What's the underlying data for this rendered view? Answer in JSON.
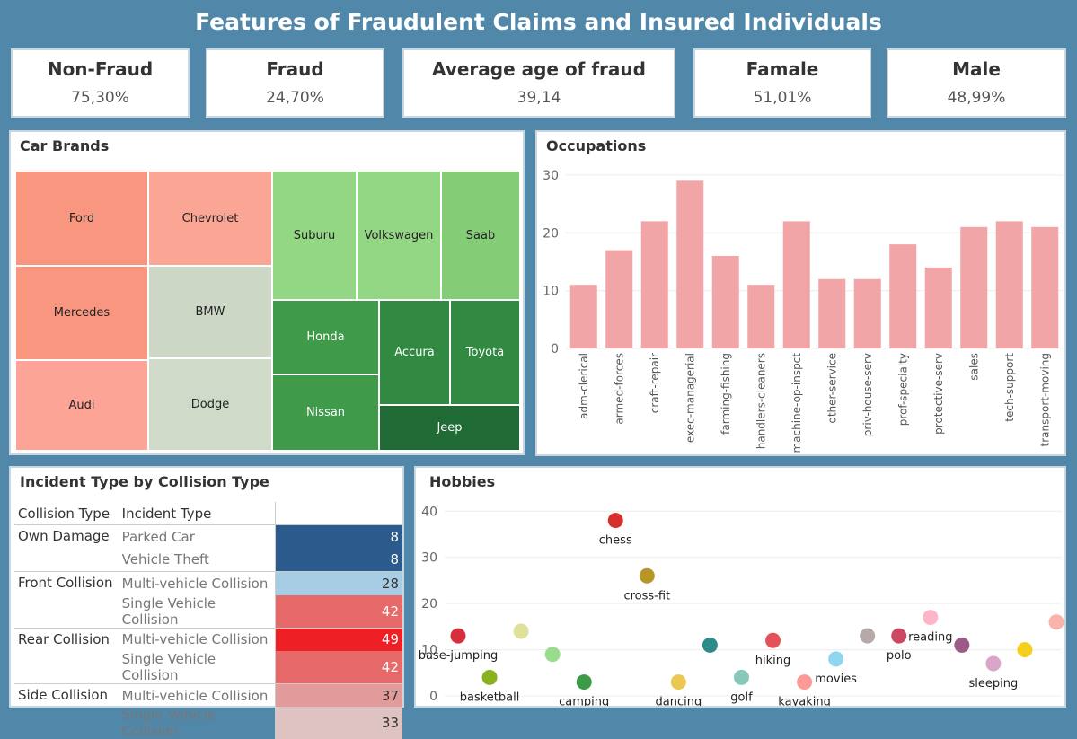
{
  "title": "Features of Fraudulent Claims and Insured Individuals",
  "kpis": [
    {
      "label": "Non-Fraud",
      "value": "75,30%"
    },
    {
      "label": "Fraud",
      "value": "24,70%"
    },
    {
      "label": "Average age of fraud",
      "value": "39,14"
    },
    {
      "label": "Famale",
      "value": "51,01%"
    },
    {
      "label": "Male",
      "value": "48,99%"
    }
  ],
  "car_brands": {
    "title": "Car Brands",
    "tiles": [
      {
        "label": "Ford",
        "color": "#f9967f"
      },
      {
        "label": "Chevrolet",
        "color": "#fba595"
      },
      {
        "label": "Mercedes",
        "color": "#f9967f"
      },
      {
        "label": "BMW",
        "color": "#cdd7c5"
      },
      {
        "label": "Audi",
        "color": "#fca597"
      },
      {
        "label": "Dodge",
        "color": "#cfdac8"
      },
      {
        "label": "Suburu",
        "color": "#93d683"
      },
      {
        "label": "Volkswagen",
        "color": "#93d683"
      },
      {
        "label": "Saab",
        "color": "#84cc76"
      },
      {
        "label": "Honda",
        "color": "#3f9a4a"
      },
      {
        "label": "Accura",
        "color": "#328a42"
      },
      {
        "label": "Toyota",
        "color": "#328a42"
      },
      {
        "label": "Nissan",
        "color": "#3f9a4a"
      },
      {
        "label": "Jeep",
        "color": "#1f6a35"
      }
    ]
  },
  "collision_table": {
    "title": "Incident Type by Collision Type",
    "headers": [
      "Collision Type",
      "Incident Type"
    ],
    "rows": [
      {
        "collision": "Own Damage",
        "incident": "Parked Car",
        "value": "8",
        "color": "#2b5b8c",
        "text_color": "#ffffff"
      },
      {
        "collision": "",
        "incident": "Vehicle Theft",
        "value": "8",
        "color": "#2b5b8c",
        "text_color": "#ffffff"
      },
      {
        "collision": "Front Collision",
        "incident": "Multi-vehicle Collision",
        "value": "28",
        "color": "#a6cde3",
        "text_color": "#333333"
      },
      {
        "collision": "",
        "incident": "Single Vehicle Collision",
        "value": "42",
        "color": "#e8696a",
        "text_color": "#ffffff"
      },
      {
        "collision": "Rear Collision",
        "incident": "Multi-vehicle Collision",
        "value": "49",
        "color": "#ee2026",
        "text_color": "#ffffff"
      },
      {
        "collision": "",
        "incident": "Single Vehicle Collision",
        "value": "42",
        "color": "#e8696a",
        "text_color": "#ffffff"
      },
      {
        "collision": "Side Collision",
        "incident": "Multi-vehicle Collision",
        "value": "37",
        "color": "#e29b9a",
        "text_color": "#333333"
      },
      {
        "collision": "",
        "incident": "Single Vehicle Collision",
        "value": "33",
        "color": "#dfc3c3",
        "text_color": "#333333"
      }
    ]
  },
  "chart_data": [
    {
      "type": "bar",
      "title": "Occupations",
      "categories": [
        "adm-clerical",
        "armed-forces",
        "craft-repair",
        "exec-managerial",
        "farming-fishing",
        "handlers-cleaners",
        "machine-op-inspct",
        "other-service",
        "priv-house-serv",
        "prof-specialty",
        "protective-serv",
        "sales",
        "tech-support",
        "transport-moving"
      ],
      "values": [
        11,
        17,
        22,
        29,
        16,
        11,
        22,
        12,
        12,
        18,
        14,
        21,
        22,
        21
      ],
      "ylim": [
        0,
        32
      ],
      "yticks": [
        0,
        10,
        20,
        30
      ],
      "color": "#f2a5a7"
    },
    {
      "type": "scatter",
      "title": "Hobbies",
      "ylim": [
        0,
        42
      ],
      "yticks": [
        0,
        10,
        20,
        30,
        40
      ],
      "points": [
        {
          "label": "base-jumping",
          "y": 13,
          "color": "#d62e3c"
        },
        {
          "label": "basketball",
          "y": 4,
          "color": "#8ab11f"
        },
        {
          "label": "",
          "y": 14,
          "color": "#dfe099"
        },
        {
          "label": "",
          "y": 9,
          "color": "#98dd8b"
        },
        {
          "label": "camping",
          "y": 3,
          "color": "#3d9a48"
        },
        {
          "label": "chess",
          "y": 38,
          "color": "#d62e2a"
        },
        {
          "label": "cross-fit",
          "y": 26,
          "color": "#b79528"
        },
        {
          "label": "dancing",
          "y": 3,
          "color": "#ebc751"
        },
        {
          "label": "",
          "y": 11,
          "color": "#2a8b88"
        },
        {
          "label": "golf",
          "y": 4,
          "color": "#88c8bb"
        },
        {
          "label": "hiking",
          "y": 12,
          "color": "#e55158"
        },
        {
          "label": "kayaking",
          "y": 3,
          "color": "#fc9a96"
        },
        {
          "label": "movies",
          "y": 8,
          "color": "#8fd6ee"
        },
        {
          "label": "",
          "y": 13,
          "color": "#b7a9a8"
        },
        {
          "label": "polo",
          "y": 13,
          "color": "#ca4862"
        },
        {
          "label": "reading",
          "y": 17,
          "color": "#fcb6c8"
        },
        {
          "label": "",
          "y": 11,
          "color": "#9c5a88"
        },
        {
          "label": "sleeping",
          "y": 7,
          "color": "#d9a6c8"
        },
        {
          "label": "",
          "y": 10,
          "color": "#f5cf1b"
        },
        {
          "label": "",
          "y": 16,
          "color": "#fbb2ab"
        }
      ]
    }
  ]
}
